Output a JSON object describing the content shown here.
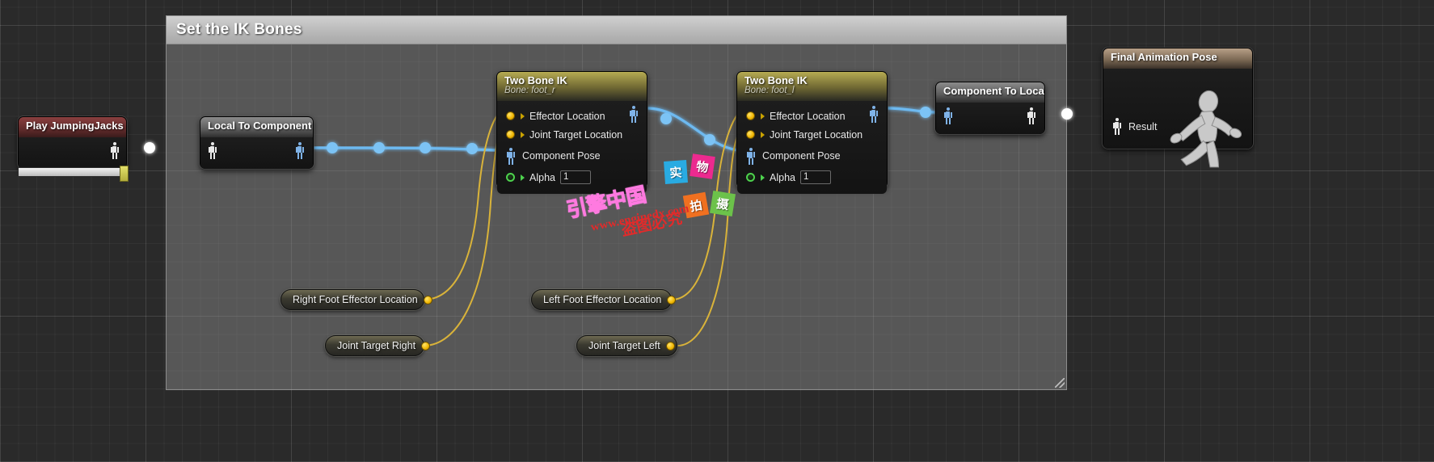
{
  "app": {
    "context": "unreal-engine-animation-blueprint-graph"
  },
  "comment": {
    "title": "Set the IK Bones"
  },
  "nodes": {
    "play_anim": {
      "title": "Play JumpingJacks",
      "header_color": "#5d2a2a",
      "output_pin": "pose"
    },
    "local_to_component": {
      "title": "Local To Component",
      "header_color": "#5a5a5a",
      "input_pin": "pose",
      "output_pin": "pose"
    },
    "two_bone_ik_right": {
      "title": "Two Bone IK",
      "subtitle": "Bone: foot_r",
      "header_color": "#6e6733",
      "pins": [
        {
          "label": "Effector Location",
          "type": "vector"
        },
        {
          "label": "Joint Target Location",
          "type": "vector"
        },
        {
          "label": "Component Pose",
          "type": "pose"
        },
        {
          "label": "Alpha",
          "type": "float",
          "value": "1"
        }
      ]
    },
    "two_bone_ik_left": {
      "title": "Two Bone IK",
      "subtitle": "Bone: foot_l",
      "header_color": "#6e6733",
      "pins": [
        {
          "label": "Effector Location",
          "type": "vector"
        },
        {
          "label": "Joint Target Location",
          "type": "vector"
        },
        {
          "label": "Component Pose",
          "type": "pose"
        },
        {
          "label": "Alpha",
          "type": "float",
          "value": "1"
        }
      ]
    },
    "component_to_local": {
      "title": "Component To Local",
      "header_color": "#5a5a5a",
      "input_pin": "pose",
      "output_pin": "pose"
    },
    "final_animation_pose": {
      "title": "Final Animation Pose",
      "header_color": "#7d6a55",
      "result_label": "Result"
    }
  },
  "getters": [
    {
      "label": "Right Foot Effector Location",
      "pin": "vector"
    },
    {
      "label": "Left Foot Effector Location",
      "pin": "vector"
    },
    {
      "label": "Joint Target Right",
      "pin": "vector"
    },
    {
      "label": "Joint Target Left",
      "pin": "vector"
    }
  ],
  "watermark": {
    "brand": "引擎中国",
    "url": "www.enginedx.com",
    "warning": "盗图必究",
    "badges": [
      "实",
      "物",
      "拍",
      "摄"
    ],
    "badge_colors": [
      "#29abe2",
      "#ec2a8f",
      "#f07020",
      "#6cc24a"
    ]
  }
}
